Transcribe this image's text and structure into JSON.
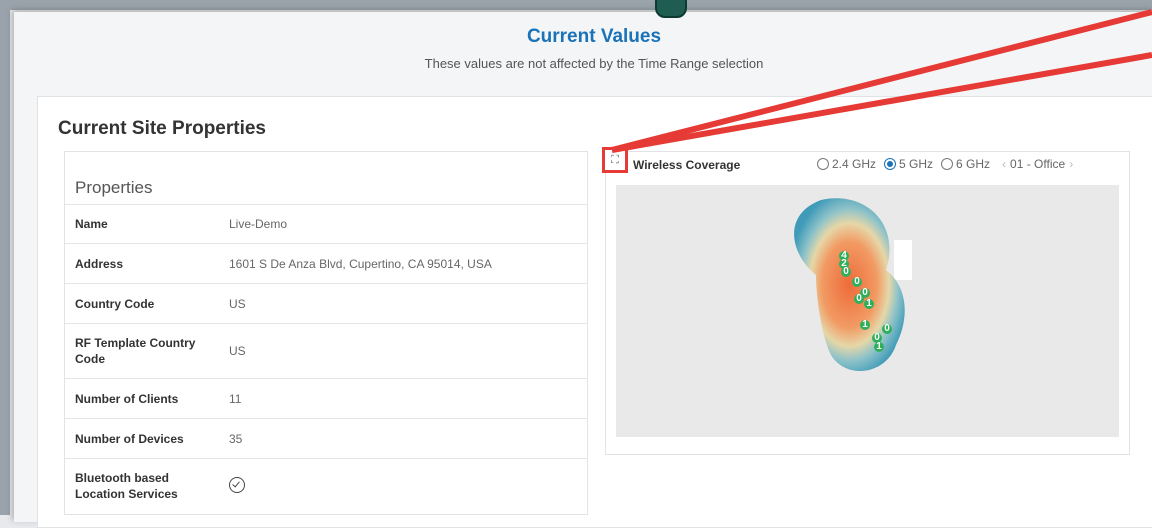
{
  "header": {
    "title": "Current Values",
    "subtitle": "These values are not affected by the Time Range selection"
  },
  "site": {
    "section_title": "Current Site Properties",
    "properties_heading": "Properties",
    "rows": [
      {
        "key": "Name",
        "value": "Live-Demo"
      },
      {
        "key": "Address",
        "value": "1601 S De Anza Blvd, Cupertino, CA 95014, USA"
      },
      {
        "key": "Country Code",
        "value": "US"
      },
      {
        "key": "RF Template Country Code",
        "value": "US"
      },
      {
        "key": "Number of Clients",
        "value": "11"
      },
      {
        "key": "Number of Devices",
        "value": "35"
      },
      {
        "key": "Bluetooth based Location Services",
        "value": ""
      }
    ]
  },
  "coverage": {
    "title": "Wireless Coverage",
    "bands": [
      {
        "label": "2.4 GHz",
        "selected": false
      },
      {
        "label": "5 GHz",
        "selected": true
      },
      {
        "label": "6 GHz",
        "selected": false
      }
    ],
    "floor": "01 - Office",
    "ap_labels": [
      "4",
      "2",
      "0",
      "0",
      "0",
      "0",
      "1",
      "1",
      "0",
      "0",
      "1"
    ]
  },
  "icons": {
    "expand": "expand-icon",
    "check": "check-circle-icon",
    "prev": "chevron-left-icon",
    "next": "chevron-right-icon"
  },
  "colors": {
    "accent": "#1a73b8",
    "callout": "#e53a35",
    "ap_marker": "#2eb05a"
  }
}
